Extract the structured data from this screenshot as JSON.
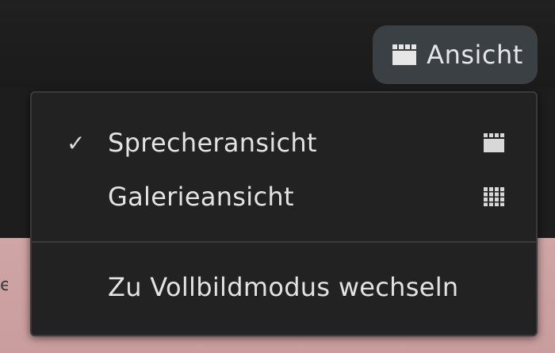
{
  "toolbar": {
    "view_button_label": "Ansicht",
    "view_button_icon": "speaker-view-icon"
  },
  "menu": {
    "items": [
      {
        "label": "Sprecheransicht",
        "checked": true,
        "icon": "speaker-view-icon"
      },
      {
        "label": "Galerieansicht",
        "checked": false,
        "icon": "gallery-view-icon"
      },
      {
        "label": "Zu Vollbildmodus wechseln",
        "checked": false,
        "icon": ""
      }
    ],
    "check_glyph": "✓"
  },
  "background": {
    "left_edge_glyph": "e"
  },
  "colors": {
    "menu_bg": "#222222",
    "button_bg": "#3b4044",
    "text": "#e3e3e3",
    "lower_bg": "#cfa5a5"
  }
}
